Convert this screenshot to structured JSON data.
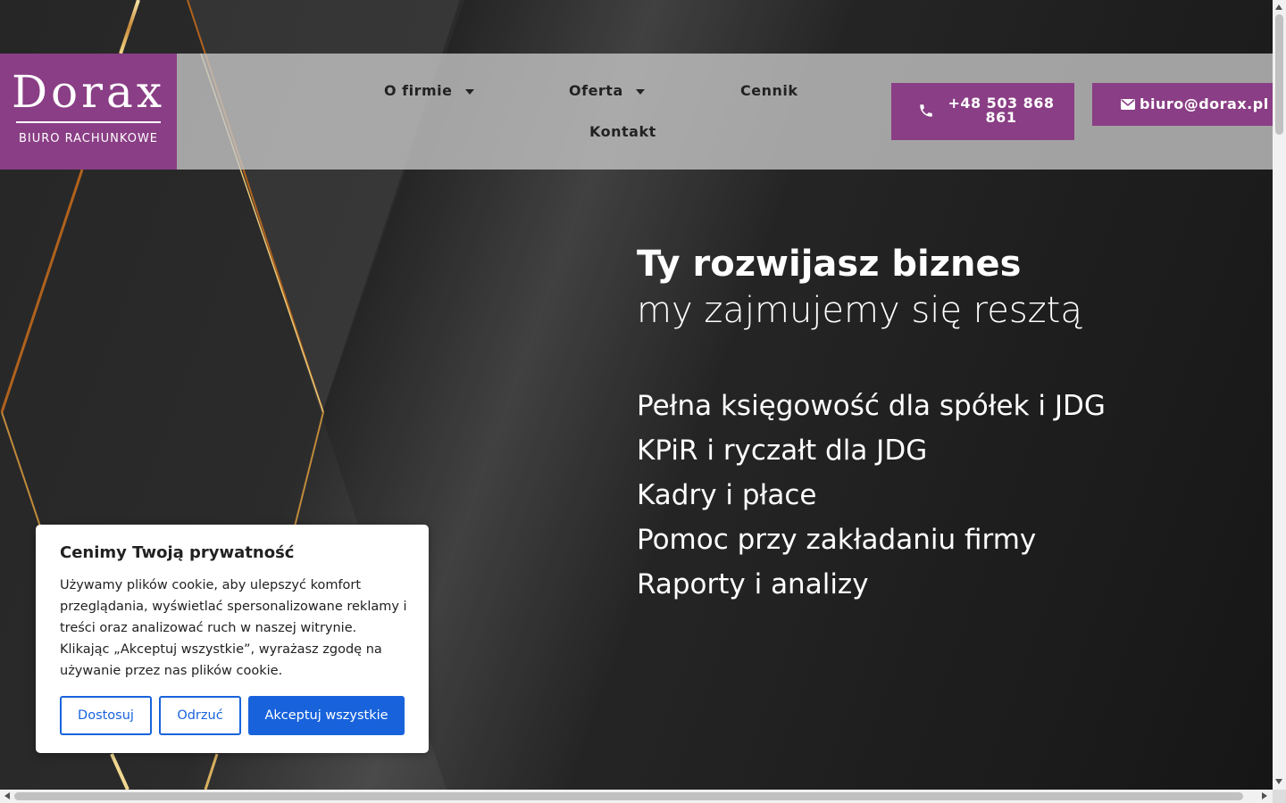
{
  "logo": {
    "name": "Dorax",
    "subtitle": "BIURO RACHUNKOWE"
  },
  "nav": {
    "items": [
      {
        "label": "O firmie",
        "has_dropdown": true
      },
      {
        "label": "Oferta",
        "has_dropdown": true
      },
      {
        "label": "Cennik",
        "has_dropdown": false
      },
      {
        "label": "Kontakt",
        "has_dropdown": false
      }
    ]
  },
  "contact": {
    "phone_line1": "+48 503 868",
    "phone_line2": "861",
    "phone_icon": "phone-icon",
    "email": "biuro@dorax.pl",
    "email_icon": "envelope-icon"
  },
  "hero": {
    "headline": "Ty rozwijasz biznes",
    "subheadline": "my zajmujemy się resztą",
    "services": [
      "Pełna księgowość dla spółek i JDG",
      "KPiR i ryczałt dla JDG",
      "Kadry i płace",
      "Pomoc przy zakładaniu firmy",
      "Raporty i analizy"
    ]
  },
  "cookie": {
    "title": "Cenimy Twoją prywatność",
    "text": "Używamy plików cookie, aby ulepszyć komfort przeglądania, wyświetlać spersonalizowane reklamy i treści oraz analizować ruch w naszej witrynie. Klikając „Akceptuj wszystkie”, wyrażasz zgodę na używanie przez nas plików cookie.",
    "customize_label": "Dostosuj",
    "reject_label": "Odrzuć",
    "accept_label": "Akceptuj wszystkie"
  },
  "colors": {
    "brand_purple": "#8a3e85",
    "cookie_blue": "#1863dc",
    "hero_dark": "#262626"
  }
}
